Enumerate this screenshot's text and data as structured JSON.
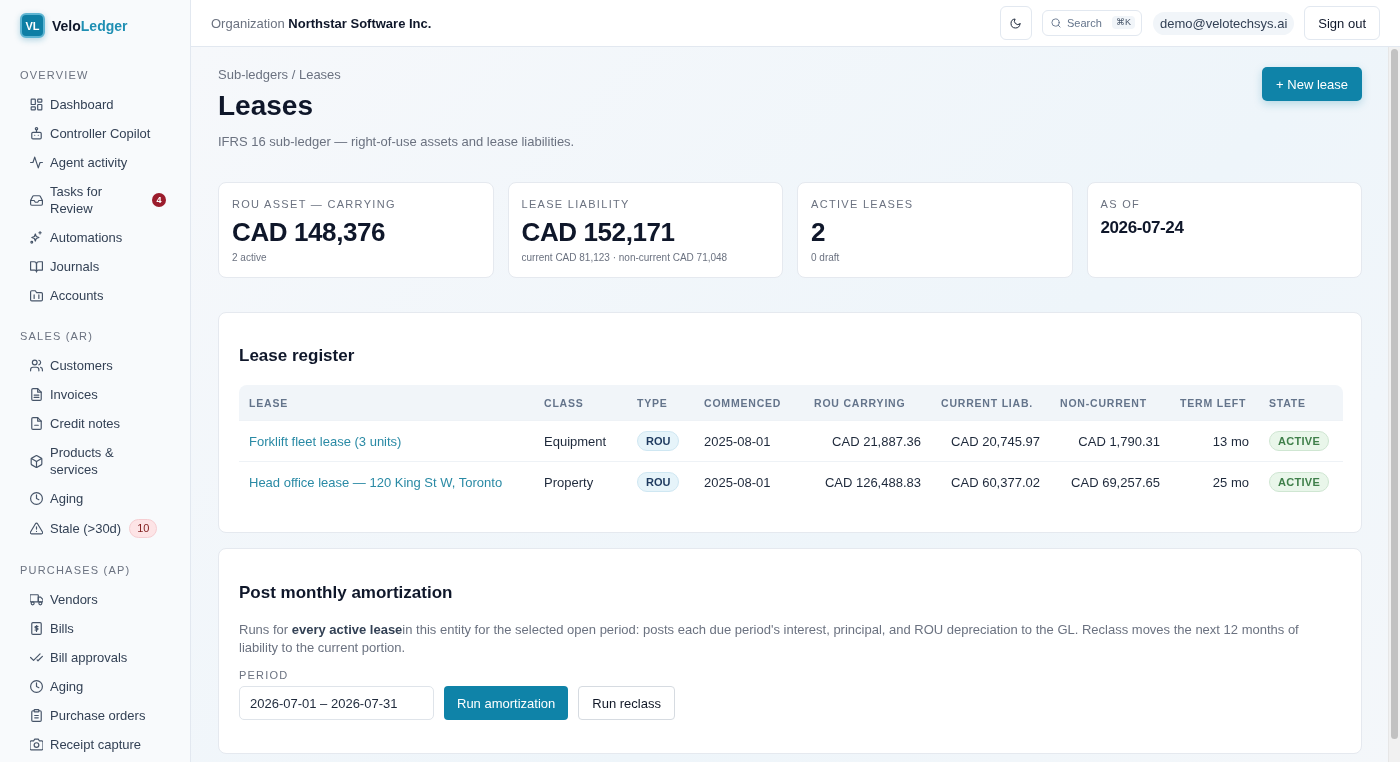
{
  "brand": {
    "logo": "VL",
    "name": "Velo",
    "name_accent": "Ledger"
  },
  "sidebar": {
    "sections": [
      {
        "title": "OVERVIEW",
        "items": [
          {
            "label": "Dashboard"
          },
          {
            "label": "Controller Copilot"
          },
          {
            "label": "Agent activity"
          },
          {
            "label": "Tasks for Review",
            "badge": {
              "text": "4",
              "kind": "alert"
            }
          },
          {
            "label": "Automations"
          },
          {
            "label": "Journals"
          },
          {
            "label": "Accounts"
          }
        ]
      },
      {
        "title": "SALES (AR)",
        "items": [
          {
            "label": "Customers"
          },
          {
            "label": "Invoices"
          },
          {
            "label": "Credit notes"
          },
          {
            "label": "Products & services"
          },
          {
            "label": "Aging"
          },
          {
            "label": "Stale (>30d)",
            "badge": {
              "text": "10",
              "kind": "soft"
            }
          }
        ]
      },
      {
        "title": "PURCHASES (AP)",
        "items": [
          {
            "label": "Vendors"
          },
          {
            "label": "Bills"
          },
          {
            "label": "Bill approvals"
          },
          {
            "label": "Aging"
          },
          {
            "label": "Purchase orders"
          },
          {
            "label": "Receipt capture"
          }
        ]
      }
    ]
  },
  "topbar": {
    "org_label": "Organization",
    "org_name": "Northstar Software Inc.",
    "search": {
      "placeholder": "Search",
      "shortcut": "⌘K"
    },
    "user_email": "demo@velotechsys.ai",
    "sign_out": "Sign out"
  },
  "page": {
    "breadcrumb": "Sub-ledgers / Leases",
    "title": "Leases",
    "subtitle": "IFRS 16 sub-ledger — right-of-use assets and lease liabilities.",
    "new_button": "+ New lease"
  },
  "stats": [
    {
      "kind": "amount",
      "label": "ROU ASSET — CARRYING",
      "value": "CAD 148,376",
      "note": "2 active"
    },
    {
      "kind": "amount",
      "label": "LEASE LIABILITY",
      "value": "CAD 152,171",
      "note": "current CAD 81,123 · non-current CAD 71,048"
    },
    {
      "kind": "amount",
      "label": "ACTIVE LEASES",
      "value": "2",
      "note": "0 draft"
    },
    {
      "kind": "date",
      "label": "AS OF",
      "value": "2026-07-24"
    }
  ],
  "register": {
    "title": "Lease register",
    "columns": [
      {
        "label": "LEASE",
        "kind": "link"
      },
      {
        "label": "CLASS",
        "kind": "text"
      },
      {
        "label": "TYPE",
        "kind": "tag"
      },
      {
        "label": "COMMENCED",
        "kind": "text"
      },
      {
        "label": "ROU CARRYING",
        "kind": "number"
      },
      {
        "label": "CURRENT LIAB.",
        "kind": "number"
      },
      {
        "label": "NON-CURRENT",
        "kind": "number"
      },
      {
        "label": "TERM LEFT",
        "kind": "number"
      },
      {
        "label": "STATE",
        "kind": "status"
      }
    ],
    "rows": [
      {
        "cells": [
          "Forklift fleet lease (3 units)",
          "Equipment",
          "ROU",
          "2025-08-01",
          "CAD 21,887.36",
          "CAD 20,745.97",
          "CAD 1,790.31",
          "13 mo",
          "ACTIVE"
        ]
      },
      {
        "cells": [
          "Head office lease — 120 King St W, Toronto",
          "Property",
          "ROU",
          "2025-08-01",
          "CAD 126,488.83",
          "CAD 60,377.02",
          "CAD 69,257.65",
          "25 mo",
          "ACTIVE"
        ]
      }
    ]
  },
  "amortization": {
    "title": "Post monthly amortization",
    "description": "Runs for **every active lease**in this entity for the selected open period: posts each due period's interest, principal, and ROU depreciation to the GL. Reclass moves the next 12 months of liability to the current portion.",
    "period_label": "PERIOD",
    "period_value": "2026-07-01 – 2026-07-31",
    "buttons": [
      {
        "label": "Run amortization",
        "kind": "primary"
      },
      {
        "label": "Run reclass",
        "kind": "secondary"
      }
    ]
  }
}
